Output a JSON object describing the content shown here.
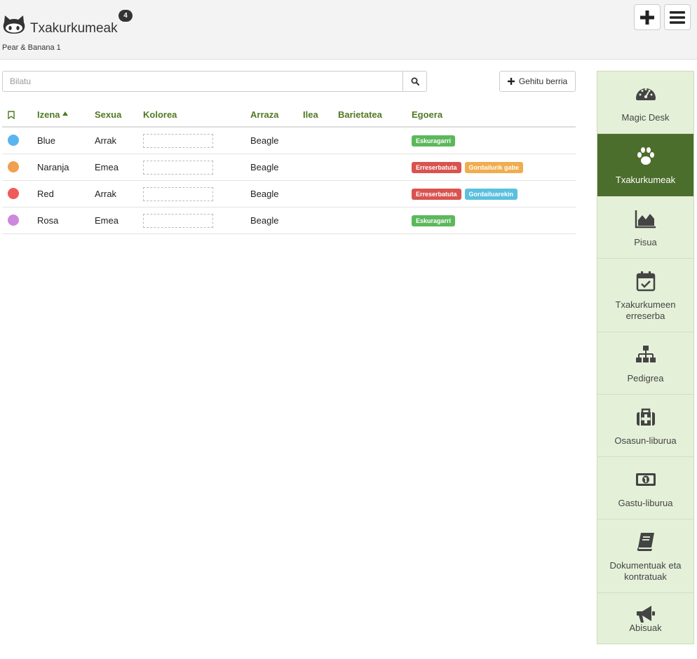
{
  "header": {
    "title": "Txakurkumeak",
    "count": "4",
    "subtitle": "Pear & Banana 1",
    "icons": {
      "logo": "github-cat-icon",
      "add": "plus-icon",
      "menu": "hamburger-menu-icon"
    }
  },
  "search": {
    "placeholder": "Bilatu",
    "value": "",
    "icon": "search-icon"
  },
  "add_button": {
    "label": "Gehitu berria",
    "icon": "plus-icon"
  },
  "table": {
    "columns": {
      "bookmark": "bookmark-icon",
      "name": "Izena",
      "sex": "Sexua",
      "color": "Kolorea",
      "breed": "Arraza",
      "hair": "Ilea",
      "variety": "Barietatea",
      "status": "Egoera"
    },
    "sort": {
      "column": "Izena",
      "direction": "ascending",
      "icon": "caret-up-icon"
    },
    "rows": [
      {
        "dot_color": "#5ab4f0",
        "name": "Blue",
        "sex": "Arrak",
        "breed": "Beagle",
        "hair": "",
        "variety": "",
        "badges": [
          {
            "label": "Eskuragarri",
            "color": "#5cb85c"
          }
        ]
      },
      {
        "dot_color": "#f0a050",
        "name": "Naranja",
        "sex": "Emea",
        "breed": "Beagle",
        "hair": "",
        "variety": "",
        "badges": [
          {
            "label": "Erreserbatuta",
            "color": "#d9534f"
          },
          {
            "label": "Gordailurik gabe",
            "color": "#f0ad4e"
          }
        ]
      },
      {
        "dot_color": "#f05a5a",
        "name": "Red",
        "sex": "Arrak",
        "breed": "Beagle",
        "hair": "",
        "variety": "",
        "badges": [
          {
            "label": "Erreserbatuta",
            "color": "#d9534f"
          },
          {
            "label": "Gordailuarekin",
            "color": "#5bc0de"
          }
        ]
      },
      {
        "dot_color": "#cc88dd",
        "name": "Rosa",
        "sex": "Emea",
        "breed": "Beagle",
        "hair": "",
        "variety": "",
        "badges": [
          {
            "label": "Eskuragarri",
            "color": "#5cb85c"
          }
        ]
      }
    ]
  },
  "sidebar": {
    "active": "Txakurkumeak",
    "items": [
      {
        "label": "Magic Desk",
        "icon": "dashboard-gauge-icon"
      },
      {
        "label": "Txakurkumeak",
        "icon": "paw-icon"
      },
      {
        "label": "Pisua",
        "icon": "area-chart-icon"
      },
      {
        "label": "Txakurkumeen erreserba",
        "icon": "calendar-check-icon"
      },
      {
        "label": "Pedigrea",
        "icon": "sitemap-icon"
      },
      {
        "label": "Osasun-liburua",
        "icon": "medkit-icon"
      },
      {
        "label": "Gastu-liburua",
        "icon": "money-bill-icon"
      },
      {
        "label": "Dokumentuak eta kontratuak",
        "icon": "book-icon"
      },
      {
        "label": "Abisuak",
        "icon": "megaphone-icon"
      }
    ]
  },
  "colors": {
    "accent": "#4f7a23",
    "sidebar_bg": "#e5f0d9",
    "sidebar_active": "#4c6e2c"
  }
}
